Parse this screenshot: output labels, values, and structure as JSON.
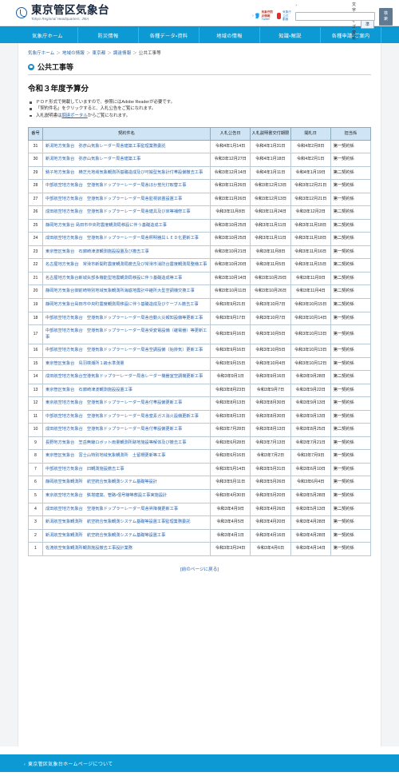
{
  "header": {
    "site_title_ja": "東京管区気象台",
    "site_title_en": "Tokyo Regional Headquarters, JMA",
    "logo_icon": "jma-circle-logo-icon",
    "fontsize_label": "文字サイズ変更",
    "fontsize_standard": "標準",
    "fontsize_large": "大",
    "search_placeholder": "",
    "search_value": "",
    "search_button": "検索",
    "twitter_line1": "気象庁防災情報",
    "twitter_line2": "Twitter",
    "youtube_line1": "気象庁",
    "youtube_line2": "公式 動画"
  },
  "nav": {
    "items": [
      {
        "label": "気象庁ホーム"
      },
      {
        "label": "防災情報"
      },
      {
        "label": "各種データ・資料"
      },
      {
        "label": "地域の情報"
      },
      {
        "label": "知識・解説"
      },
      {
        "label": "各種申請・ご案内"
      }
    ]
  },
  "breadcrumb": {
    "items": [
      {
        "label": "気象庁ホーム"
      },
      {
        "label": "地域の情報"
      },
      {
        "label": "東京都"
      },
      {
        "label": "調達情報"
      },
      {
        "label": "公共工事等"
      }
    ],
    "separator": "＞"
  },
  "page": {
    "title": "公共工事等",
    "subtitle": "令和３年度予算分",
    "notes": [
      "ＰＤＦ形式で掲載していますので、参照にはAdobe Readerが必要です。",
      "「契約件名」をクリックすると、入札公告をご覧になれます。",
      "入札説明書は調達ポータルからご覧になれます。"
    ],
    "note_link_text": "調達ポータル",
    "back_link": "[前のページに戻る]"
  },
  "table": {
    "columns": [
      "番号",
      "契約件名",
      "入札公告日",
      "入札説明書交付期限",
      "開札日",
      "担当係"
    ],
    "rows": [
      {
        "no": "31",
        "name": "新潟地方気象台　弥彦山気象レーダー局舎建築工事監理業務委託",
        "notice": "令和4年1月14日",
        "deadline": "令和4年1月31日",
        "open": "令和4年2月8日",
        "section": "第一契約係"
      },
      {
        "no": "30",
        "name": "新潟地方気象台　弥彦山気象レーダー局舎建築工事",
        "notice": "令和3年12月27日",
        "deadline": "令和4年1月18日",
        "open": "令和4年2月1日",
        "section": "第一契約係"
      },
      {
        "no": "29",
        "name": "銚子地方気象台　横芝光地域気象観測所基礎造成及び可搬型気象計付帯設備撤去工事",
        "notice": "令和3年12月14日",
        "deadline": "令和4年1月11日",
        "open": "令和4年1月19日",
        "section": "第二契約係"
      },
      {
        "no": "28",
        "name": "中部航空地方気象台　空港気象ドップラーレーダー局舎ほか蛍光灯取替工事",
        "notice": "令和3年11月26日",
        "deadline": "令和3年12月13日",
        "open": "令和3年12月21日",
        "section": "第一契約係"
      },
      {
        "no": "27",
        "name": "中部航空地方気象台　空港気象ドップラーレーダー局舎監視装置設置工事",
        "notice": "令和3年11月26日",
        "deadline": "令和3年12月13日",
        "open": "令和3年12月21日",
        "section": "第一契約係"
      },
      {
        "no": "26",
        "name": "成田航空地方気象台　空港気象ドップラーレーダー局舎建具及び床等補修工事",
        "notice": "令和3年11月8日",
        "deadline": "令和3年11月24日",
        "open": "令和3年12月2日",
        "section": "第二契約係"
      },
      {
        "no": "25",
        "name": "静岡地方気象台 島田市中央町震度観測局移設に伴う基礎造成工事",
        "notice": "令和3年10月25日",
        "deadline": "令和3年11月11日",
        "open": "令和3年11月18日",
        "section": "第二契約係"
      },
      {
        "no": "24",
        "name": "成田航空地方気象台　空港気象ドップラーレーダー局舎照明器具ＬＥＤ化更新工事",
        "notice": "令和3年10月25日",
        "deadline": "令和3年11月11日",
        "open": "令和3年11月18日",
        "section": "第二契約係"
      },
      {
        "no": "23",
        "name": "東京管区気象台　石廊崎津波観測施設設置及び撤去工事",
        "notice": "令和3年10月21日",
        "deadline": "令和3年11月8日",
        "open": "令和3年11月16日",
        "section": "第一契約係"
      },
      {
        "no": "22",
        "name": "名古屋地方気象台　常滑市新開町震度観測局撤去及び常滑市消防台震度観測局整備工事",
        "notice": "令和3年10月20日",
        "deadline": "令和3年11月5日",
        "open": "令和3年11月15日",
        "section": "第二契約係"
      },
      {
        "no": "21",
        "name": "名古屋地方気象台新城矢部多機能型地震観測局移設に伴う基礎造成等工事",
        "notice": "令和3年10月14日",
        "deadline": "令和3年10月29日",
        "open": "令和3年11月9日",
        "section": "第二契約係"
      },
      {
        "no": "20",
        "name": "静岡地方気象台御前崎特別地域気象観測所海底地震計中継所大型空調機交換工事",
        "notice": "令和3年10月11日",
        "deadline": "令和3年10月26日",
        "open": "令和3年11月4日",
        "section": "第二契約係"
      },
      {
        "no": "19",
        "name": "静岡地方気象台島田市中央町震度観測局移設に伴う基礎造成及びケーブル撤去工事",
        "notice": "令和3年9月21日",
        "deadline": "令和3年10月7日",
        "open": "令和3年10月15日",
        "section": "第二契約係"
      },
      {
        "no": "18",
        "name": "中部航空地方気象台　空港気象ドップラーレーダー局舎自動火災報知設備等更新工事",
        "notice": "令和3年9月17日",
        "deadline": "令和3年10月7日",
        "open": "令和3年10月14日",
        "section": "第一契約係"
      },
      {
        "no": "17",
        "name": "中部航空地方気象台　空港気象ドップラーレーダー局舎受変電設備（継電器）等更新工事",
        "notice": "令和3年9月16日",
        "deadline": "令和3年10月5日",
        "open": "令和3年10月13日",
        "section": "第一契約係"
      },
      {
        "no": "16",
        "name": "中部航空地方気象台　空港気象ドップラーレーダー局舎空調設備（始排気）更新工事",
        "notice": "令和3年9月16日",
        "deadline": "令和3年10月5日",
        "open": "令和3年10月13日",
        "section": "第一契約係"
      },
      {
        "no": "15",
        "name": "東京管区気象台　鳥羽検潮所１級水準測量",
        "notice": "令和3年9月15日",
        "deadline": "令和3年10月4日",
        "open": "令和3年10月12日",
        "section": "第一契約係"
      },
      {
        "no": "14",
        "name": "成田航空地方気象台空港気象ドップラーレーダー局舎レーダー機器室空調機更新工事",
        "notice": "令和3年9月1日",
        "deadline": "令和3年9月16日",
        "open": "令和3年9月28日",
        "section": "第二契約係"
      },
      {
        "no": "13",
        "name": "東京管区気象台　石廊崎津波観測施設設置工事",
        "notice": "令和3年8月23日",
        "deadline": "令和3年9月7日",
        "open": "令和3年9月22日",
        "section": "第一契約係"
      },
      {
        "no": "12",
        "name": "東京航空地方気象台　空港気象ドップラーレーダー局舎付帯設備更新工事",
        "notice": "令和3年8月13日",
        "deadline": "令和3年8月30日",
        "open": "令和3年9月13日",
        "section": "第一契約係"
      },
      {
        "no": "11",
        "name": "中部航空地方気象台　空港気象ドップラーレーダー局舎窒素ガス消火設備更新工事",
        "notice": "令和3年8月13日",
        "deadline": "令和3年8月30日",
        "open": "令和3年9月13日",
        "section": "第一契約係"
      },
      {
        "no": "10",
        "name": "成田航空地方気象台　空港気象ドップラーレーダー局舎付帯設備更新工事",
        "notice": "令和3年7月28日",
        "deadline": "令和3年8月13日",
        "open": "令和3年8月25日",
        "section": "第二契約係"
      },
      {
        "no": "9",
        "name": "長野地方気象台　笠岳無線ロボット雨量観測所跡地施設等解体及び撤去工事",
        "notice": "令和3年6月28日",
        "deadline": "令和3年7月13日",
        "open": "令和3年7月21日",
        "section": "第一契約係"
      },
      {
        "no": "8",
        "name": "東京管区気象台　富士山特別地域気象観測所　土留柵更新等工事",
        "notice": "令和3年6月16日",
        "deadline": "令和3年7月2日",
        "open": "令和3年7月9日",
        "section": "第一契約係"
      },
      {
        "no": "7",
        "name": "中部航空地方気象台　旧観測施設撤去工事",
        "notice": "令和3年5月14日",
        "deadline": "令和3年5月31日",
        "open": "令和3年6月10日",
        "section": "第一契約係"
      },
      {
        "no": "6",
        "name": "静岡航空気象観測所　航空統合気象観測システム基礎等設計",
        "notice": "令和3年5月11日",
        "deadline": "令和3年5月26日",
        "open": "令和3年6月4日",
        "section": "第一契約係"
      },
      {
        "no": "5",
        "name": "東京航空地方気象台　鉄塔建築、管路・信号線等敷設工事実施設計",
        "notice": "令和3年4月30日",
        "deadline": "令和3年5月20日",
        "open": "令和3年5月28日",
        "section": "第一契約係"
      },
      {
        "no": "4",
        "name": "成田航空地方気象台　空港気象ドップラーレーダー局舎昇降機更新工事",
        "notice": "令和3年4月9日",
        "deadline": "令和3年4月26日",
        "open": "令和3年5月13日",
        "section": "第二契約係"
      },
      {
        "no": "3",
        "name": "新潟航空気象観測所　航空統合気象観測システム基礎等設置工事監理業務委託",
        "notice": "令和3年4月5日",
        "deadline": "令和3年4月20日",
        "open": "令和3年4月28日",
        "section": "第一契約係"
      },
      {
        "no": "2",
        "name": "新潟航空気象観測所　航空統合気象観測システム基礎等設置工事",
        "notice": "令和3年4月1日",
        "deadline": "令和3年4月16日",
        "open": "令和3年4月28日",
        "section": "第一契約係"
      },
      {
        "no": "1",
        "name": "佐渡航空気象観測所観測施設撤去工事設計業務",
        "notice": "令和3年3月24日",
        "deadline": "令和3年4月6日",
        "open": "令和3年4月14日",
        "section": "第一契約係"
      }
    ]
  },
  "footer": {
    "link": "東京管区気象台ホームページについて",
    "arrow": "›"
  },
  "colors": {
    "nav_blue": "#0d9ad4",
    "link_blue": "#2b66b0",
    "table_header": "#cfe4f5"
  }
}
